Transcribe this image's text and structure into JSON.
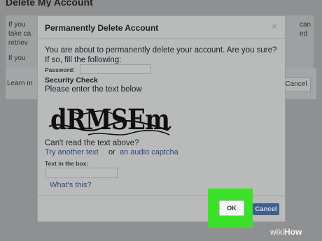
{
  "background": {
    "header": "Delete My Account",
    "lines": [
      "If you",
      "take ca",
      "retriev",
      "If you"
    ],
    "right_fragments": [
      "can",
      "ed"
    ],
    "learn_more": "Learn m",
    "cancel": "Cancel"
  },
  "dialog": {
    "title": "Permanently Delete Account",
    "close": "×",
    "message": "You are about to permanently delete your account. Are you sure?",
    "fill_prompt": "If so, fill the following:",
    "password_label": "Password:",
    "security_check": "Security Check",
    "enter_text": "Please enter the text below",
    "captcha_text": "dRMSEm",
    "cant_read": "Can't read the text above?",
    "try_another": "Try another text",
    "or": "or",
    "audio_captcha": "an audio captcha",
    "text_in_box_label": "Text in the box:",
    "whats_this": "What's this?",
    "ok_button": "OK",
    "cancel_button": "Cancel"
  },
  "colors": {
    "highlight": "#3be02b",
    "link": "#2c4a86",
    "primary_button": "#3f5f8f"
  },
  "watermark": {
    "brand_light": "wiki",
    "brand_bold": "How"
  }
}
